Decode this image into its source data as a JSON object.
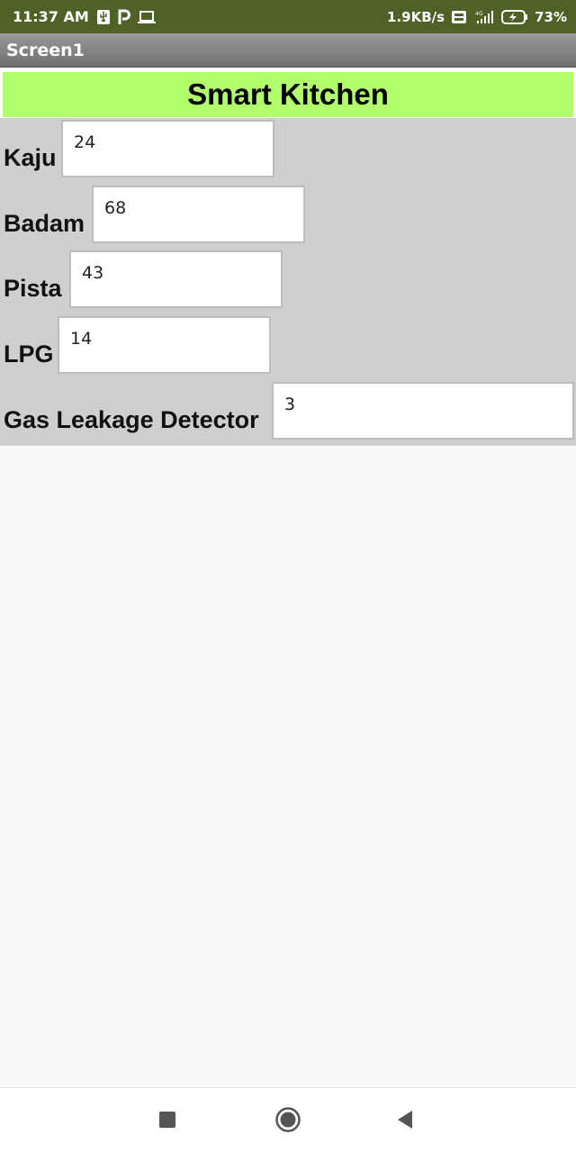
{
  "status_bar": {
    "time": "11:37 AM",
    "network_speed": "1.9KB/s",
    "battery_percent": "73%",
    "icons": [
      "usb-icon",
      "p-app-icon",
      "laptop-icon",
      "volte-icon",
      "signal-4g-icon",
      "battery-charging-icon"
    ]
  },
  "app_bar": {
    "title": "Screen1"
  },
  "header": {
    "title": "Smart Kitchen",
    "background_color": "#b2ff6e"
  },
  "fields": [
    {
      "label": "Kaju",
      "value": "24"
    },
    {
      "label": "Badam",
      "value": "68"
    },
    {
      "label": "Pista",
      "value": "43"
    },
    {
      "label": "LPG",
      "value": "14"
    },
    {
      "label": "Gas Leakage Detector",
      "value": "3"
    }
  ],
  "nav_bar": {
    "buttons": [
      "recents-square-icon",
      "home-circle-icon",
      "back-triangle-icon"
    ]
  },
  "colors": {
    "status_bar": "#4e6126",
    "title_bar": "#808080",
    "panel": "#cfcfcf"
  }
}
